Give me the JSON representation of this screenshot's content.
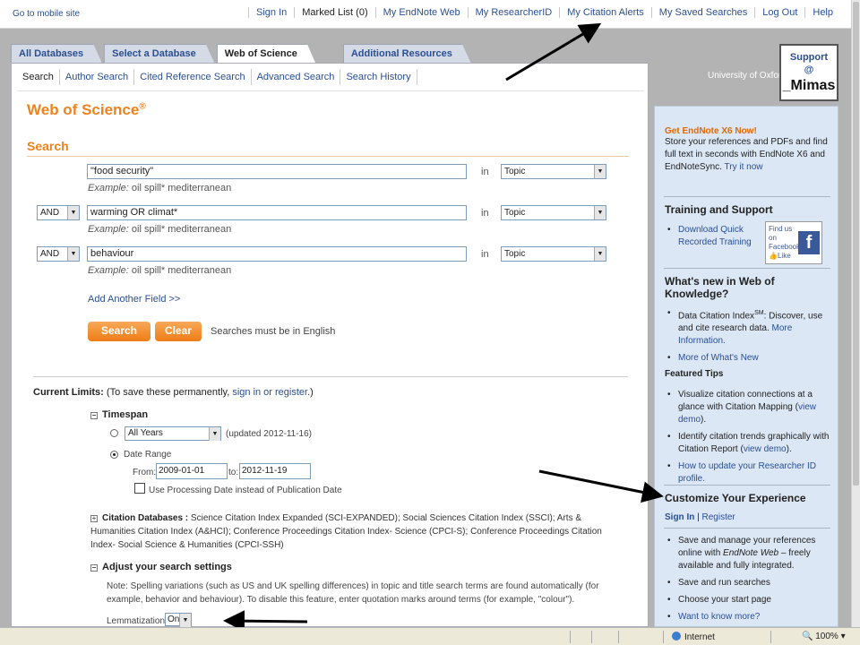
{
  "topbar": {
    "mobile": "Go to mobile site",
    "nav": [
      "Sign In",
      "Marked List (0)",
      "My EndNote Web",
      "My ResearcherID",
      "My Citation Alerts",
      "My Saved Searches",
      "Log Out",
      "Help"
    ]
  },
  "tabs": [
    "All Databases",
    "Select a Database",
    "Web of Science",
    "Additional Resources"
  ],
  "institution": "University of Oxford",
  "support": {
    "line1": "Support",
    "line2": "@",
    "logo": "_Mimas"
  },
  "subnav": [
    "Search",
    "Author Search",
    "Cited Reference Search",
    "Advanced Search",
    "Search History"
  ],
  "page": {
    "title": "Web of Science",
    "title_mark": "®",
    "section": "Search"
  },
  "search_rows": [
    {
      "op": "",
      "term": "\"food security\"",
      "example_label": "Example:",
      "example": "oil spill* mediterranean",
      "in": "in",
      "field": "Topic"
    },
    {
      "op": "AND",
      "term": "warming OR climat*",
      "example_label": "Example:",
      "example": "oil spill* mediterranean",
      "in": "in",
      "field": "Topic"
    },
    {
      "op": "AND",
      "term": "behaviour",
      "example_label": "Example:",
      "example": "oil spill* mediterranean",
      "in": "in",
      "field": "Topic"
    }
  ],
  "add_field": "Add Another Field >>",
  "buttons": {
    "search": "Search",
    "clear": "Clear"
  },
  "english_note": "Searches must be in English",
  "limits": {
    "label": "Current Limits:",
    "note_pre": "(To save these permanently, ",
    "note_link": "sign in or register",
    "note_post": ".)",
    "timespan": "Timespan",
    "all_years": "All Years",
    "updated": "(updated 2012-11-16)",
    "date_range": "Date Range",
    "from": "From:",
    "from_value": "2009-01-01",
    "to": "to:",
    "to_value": "2012-11-19",
    "processing": "Use Processing Date instead of Publication Date",
    "citdb_label": "Citation Databases :",
    "citdb_text": "Science Citation Index Expanded (SCI-EXPANDED); Social Sciences Citation Index (SSCI); Arts & Humanities Citation Index (A&HCI); Conference Proceedings Citation Index- Science (CPCI-S); Conference Proceedings Citation Index- Social Science & Humanities (CPCI-SSH)",
    "adjust": "Adjust your search settings",
    "spelling_note": "Note: Spelling variations (such as US and UK spelling differences) in topic and title search terms are found automatically (for example, behavior and behaviour). To disable this feature, enter quotation marks around terms (for example, \"colour\").",
    "lemmatization": "Lemmatization",
    "lemmatization_value": "On"
  },
  "sidebar": {
    "endnote_head": "Get EndNote X6 Now!",
    "endnote_text": "Store your references and PDFs and find full text in seconds with EndNote X6 and EndNoteSync.",
    "endnote_link": "Try it now",
    "training_head": "Training and Support",
    "training_link": "Download Quick Recorded Training",
    "fb_text": "Find us on Facebook",
    "fb_like": "Like",
    "whatsnew_head": "What's new in Web of Knowledge?",
    "wn1_text": "Data Citation Index",
    "wn1_sm": "SM",
    "wn1_rest": ": Discover, use and cite research data.",
    "wn1_link": "More Information.",
    "wn2": "More of What's New",
    "tips_head": "Featured Tips",
    "tip1": "Visualize citation connections at a glance with Citation Mapping",
    "tip1_link": "view demo",
    "tip2": "Identify citation trends graphically with Citation Report",
    "tip2_link": "view demo",
    "tip3": "How to update your Researcher ID profile.",
    "customize_head": "Customize Your Experience",
    "signin": "Sign In",
    "register": "Register",
    "c1_pre": "Save and manage your references online with",
    "c1_em": "EndNote Web",
    "c1_post": "– freely available and fully integrated.",
    "c2": "Save and run searches",
    "c3": "Choose your start page",
    "c4": "Want to know more?"
  },
  "statusbar": {
    "zone": "Internet",
    "zoom": "100%"
  }
}
